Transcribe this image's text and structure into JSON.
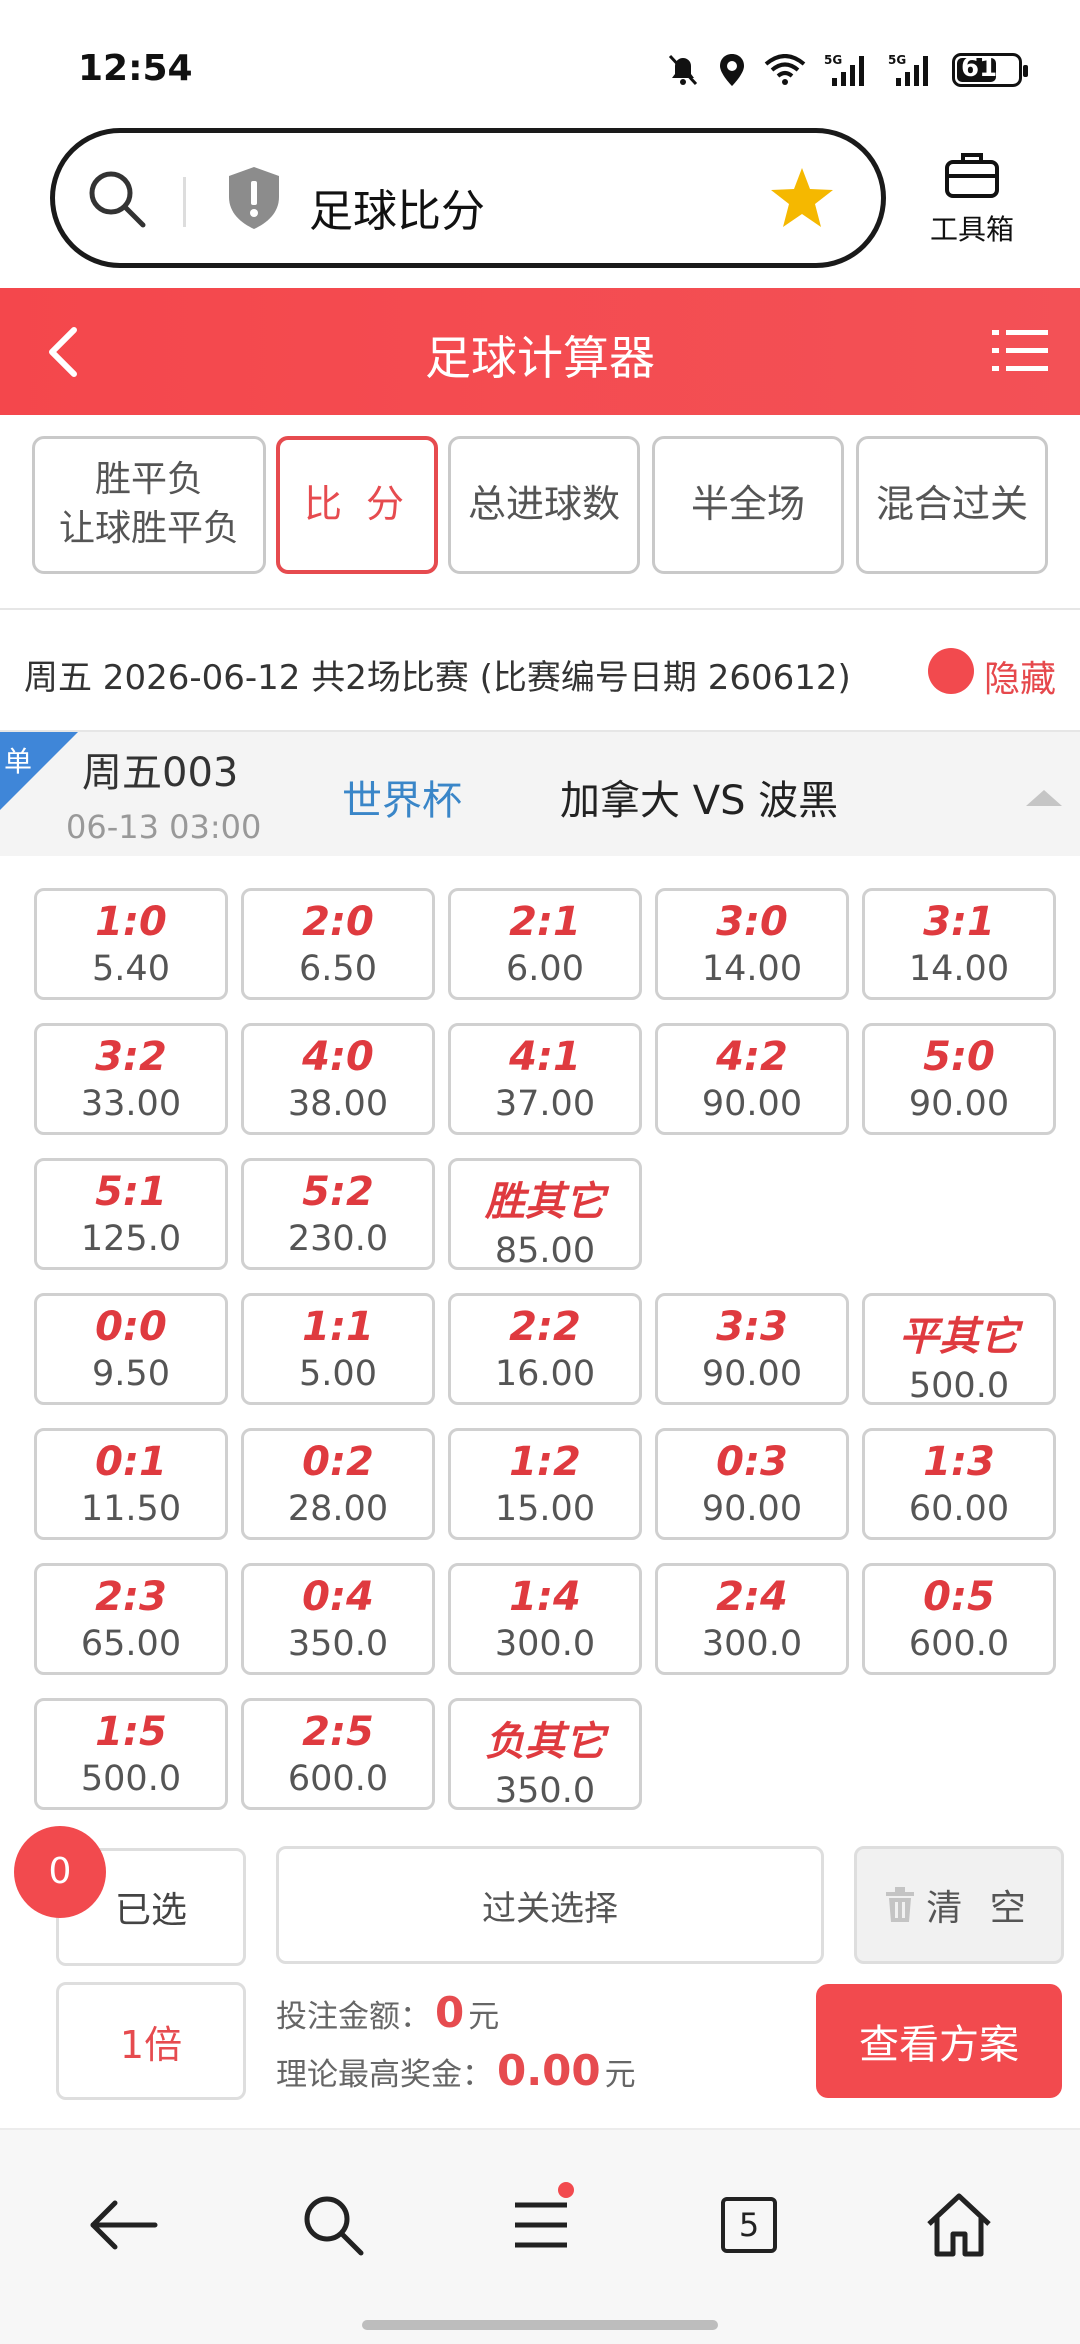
{
  "status": {
    "time": "12:54",
    "battery": "61"
  },
  "browser": {
    "url_text": "足球比分",
    "toolbox_label": "工具箱"
  },
  "header": {
    "title": "足球计算器"
  },
  "tabs": [
    {
      "line1": "胜平负",
      "line2": "让球胜平负"
    },
    {
      "line1": "比 分"
    },
    {
      "line1": "总进球数"
    },
    {
      "line1": "半全场"
    },
    {
      "line1": "混合过关"
    }
  ],
  "date_row": {
    "text": "周五 2026-06-12 共2场比赛 (比赛编号日期 260612)",
    "hide_label": "隐藏"
  },
  "match": {
    "badge": "单",
    "number": "周五003",
    "time": "06-13 03:00",
    "league": "世界杯",
    "teams": "加拿大 VS 波黑"
  },
  "odds": [
    [
      {
        "score": "1:0",
        "odd": "5.40"
      },
      {
        "score": "2:0",
        "odd": "6.50"
      },
      {
        "score": "2:1",
        "odd": "6.00"
      },
      {
        "score": "3:0",
        "odd": "14.00"
      },
      {
        "score": "3:1",
        "odd": "14.00"
      }
    ],
    [
      {
        "score": "3:2",
        "odd": "33.00"
      },
      {
        "score": "4:0",
        "odd": "38.00"
      },
      {
        "score": "4:1",
        "odd": "37.00"
      },
      {
        "score": "4:2",
        "odd": "90.00"
      },
      {
        "score": "5:0",
        "odd": "90.00"
      }
    ],
    [
      {
        "score": "5:1",
        "odd": "125.0"
      },
      {
        "score": "5:2",
        "odd": "230.0"
      },
      {
        "score": "胜其它",
        "odd": "85.00"
      }
    ],
    [
      {
        "score": "0:0",
        "odd": "9.50"
      },
      {
        "score": "1:1",
        "odd": "5.00"
      },
      {
        "score": "2:2",
        "odd": "16.00"
      },
      {
        "score": "3:3",
        "odd": "90.00"
      },
      {
        "score": "平其它",
        "odd": "500.0"
      }
    ],
    [
      {
        "score": "0:1",
        "odd": "11.50"
      },
      {
        "score": "0:2",
        "odd": "28.00"
      },
      {
        "score": "1:2",
        "odd": "15.00"
      },
      {
        "score": "0:3",
        "odd": "90.00"
      },
      {
        "score": "1:3",
        "odd": "60.00"
      }
    ],
    [
      {
        "score": "2:3",
        "odd": "65.00"
      },
      {
        "score": "0:4",
        "odd": "350.0"
      },
      {
        "score": "1:4",
        "odd": "300.0"
      },
      {
        "score": "2:4",
        "odd": "300.0"
      },
      {
        "score": "0:5",
        "odd": "600.0"
      }
    ],
    [
      {
        "score": "1:5",
        "odd": "500.0"
      },
      {
        "score": "2:5",
        "odd": "600.0"
      },
      {
        "score": "负其它",
        "odd": "350.0"
      }
    ]
  ],
  "footer": {
    "selected_count": "0",
    "selected_label": "已选",
    "pass_label": "过关选择",
    "clear_label": "清 空",
    "multiplier_label": "1倍",
    "bet_amount_label": "投注金额：",
    "bet_amount": "0",
    "bet_unit": "元",
    "max_prize_label": "理论最高奖金：",
    "max_prize": "0.00",
    "prize_unit": "元",
    "plan_label": "查看方案"
  },
  "nav": {
    "tabs_count": "5"
  },
  "colors": {
    "accent": "#f24a4e",
    "league": "#3a86c8",
    "badge_blue": "#3f86d8"
  }
}
